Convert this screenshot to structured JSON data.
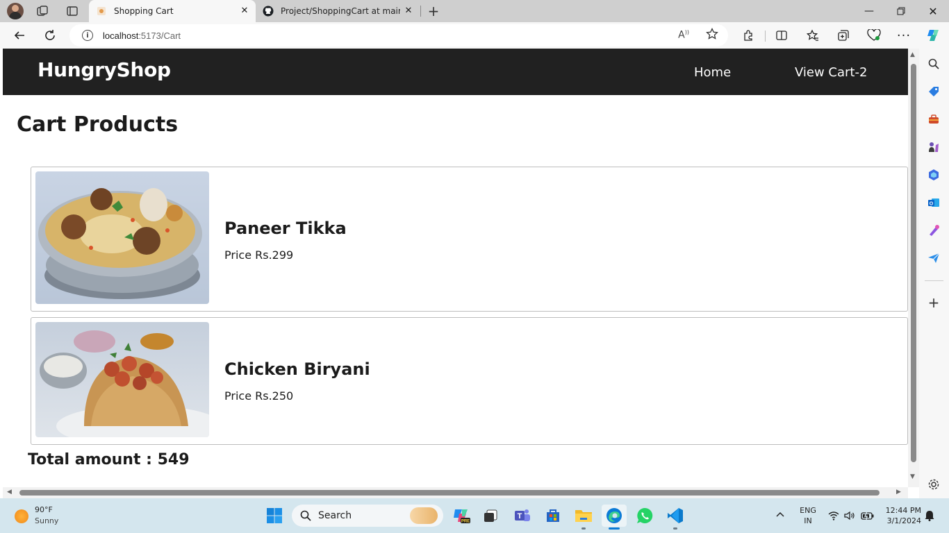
{
  "browser": {
    "tabs": [
      {
        "title": "Shopping Cart",
        "active": true
      },
      {
        "title": "Project/ShoppingCart at main · S",
        "active": false
      }
    ],
    "url_host": "localhost",
    "url_path": ":5173/Cart"
  },
  "app": {
    "brand": "HungryShop",
    "nav_home": "Home",
    "nav_cart": "View Cart-2",
    "page_title": "Cart Products",
    "products": [
      {
        "name": "Paneer Tikka",
        "price": "Price Rs.299"
      },
      {
        "name": "Chicken Biryani",
        "price": "Price Rs.250"
      }
    ],
    "total": "Total amount : 549"
  },
  "taskbar": {
    "weather_temp": "90°F",
    "weather_desc": "Sunny",
    "search_label": "Search",
    "lang_top": "ENG",
    "lang_bottom": "IN",
    "time": "12:44 PM",
    "date": "3/1/2024"
  },
  "colors": {
    "navbar": "#212121",
    "taskbar": "#d4e6ee",
    "edge_blue": "#0c7bd6"
  }
}
